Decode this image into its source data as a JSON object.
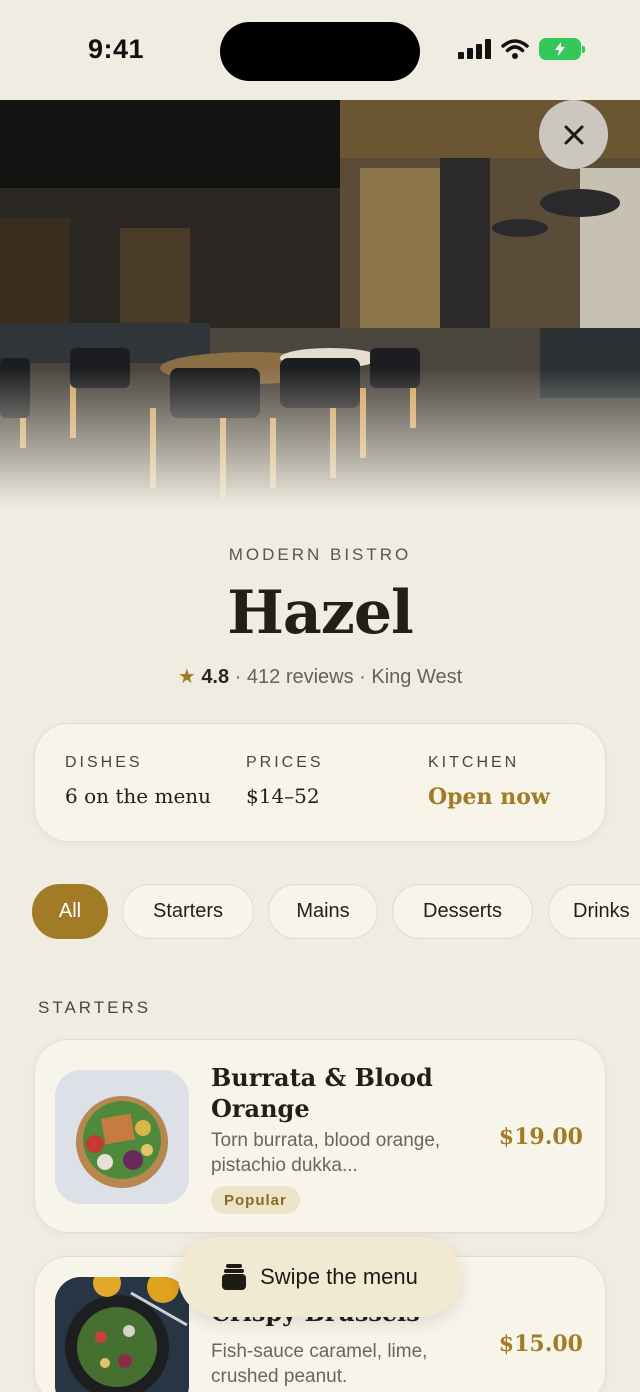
{
  "status_bar": {
    "time": "9:41"
  },
  "hero": {
    "close_label": "✕"
  },
  "restaurant": {
    "category": "MODERN BISTRO",
    "name": "Hazel",
    "star": "★",
    "rating": "4.8",
    "reviews": " · 412 reviews · King West"
  },
  "info": {
    "dishes_label": "DISHES",
    "dishes_value": "6 on the menu",
    "prices_label": "PRICES",
    "prices_value": "$14–52",
    "kitchen_label": "KITCHEN",
    "kitchen_value": "Open now"
  },
  "filters": [
    "All",
    "Starters",
    "Mains",
    "Desserts",
    "Drinks"
  ],
  "section": {
    "title": "STARTERS"
  },
  "dishes": [
    {
      "name": "Burrata & Blood Orange",
      "description": "Torn burrata, blood orange, pistachio dukka...",
      "price": "$19.00",
      "badge": "Popular"
    },
    {
      "name": "Crispy Brussels",
      "description": "Fish-sauce caramel, lime, crushed peanut.",
      "price": "$15.00"
    }
  ],
  "swipe_hint": {
    "label": "Swipe the menu",
    "icon": "menu-stack-icon"
  },
  "colors": {
    "accent": "#a27b26",
    "background": "#efece1",
    "card": "#f7f4ea",
    "battery": "#34c759"
  }
}
